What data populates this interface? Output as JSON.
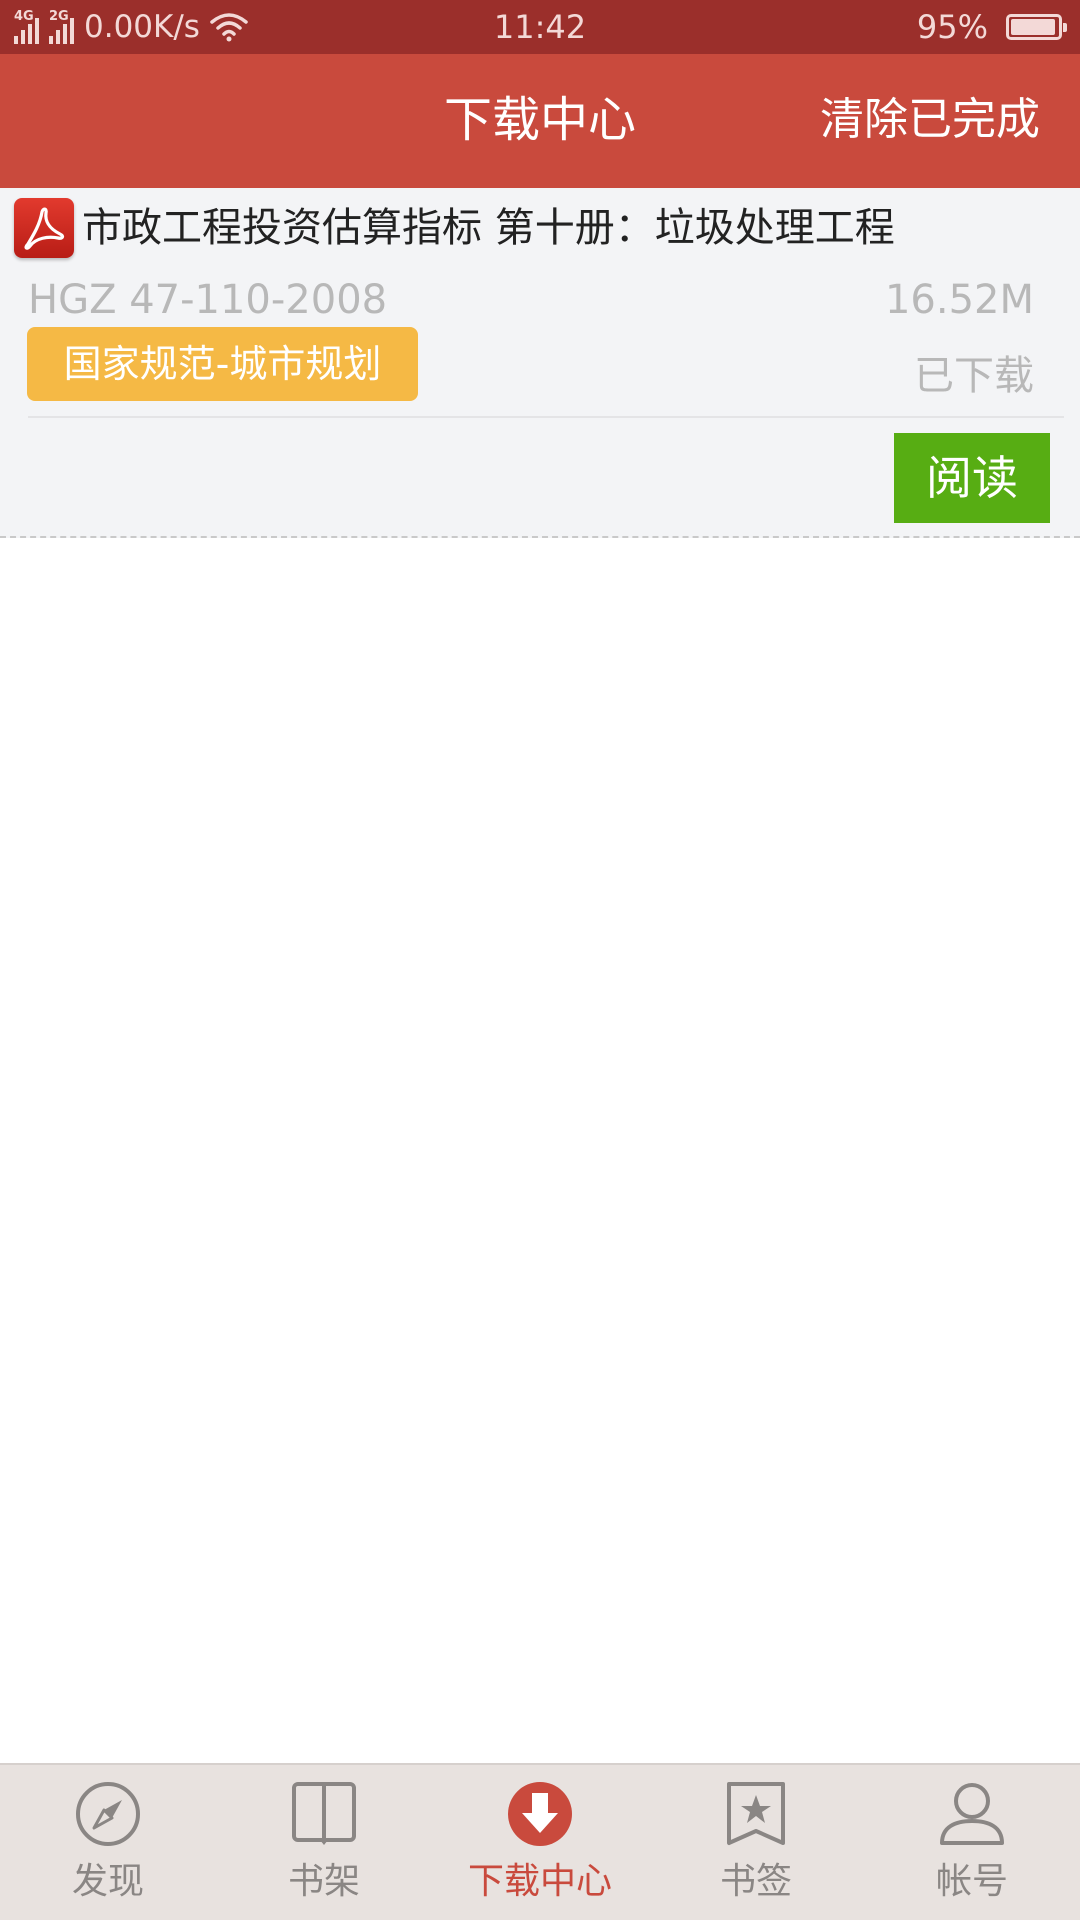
{
  "status_bar": {
    "network1": "4G",
    "network2": "2G",
    "speed": "0.00K/s",
    "time": "11:42",
    "battery": "95%",
    "battery_level": 0.95
  },
  "header": {
    "title": "下载中心",
    "clear_label": "清除已完成"
  },
  "downloads": [
    {
      "icon": "pdf-icon",
      "title": "市政工程投资估算指标 第十册：垃圾处理工程",
      "code": "HGZ 47-110-2008",
      "size": "16.52M",
      "category": "国家规范-城市规划",
      "status": "已下载",
      "action_label": "阅读"
    }
  ],
  "bottom_nav": {
    "items": [
      {
        "label": "发现",
        "icon": "compass-icon",
        "active": false
      },
      {
        "label": "书架",
        "icon": "book-icon",
        "active": false
      },
      {
        "label": "下载中心",
        "icon": "download-icon",
        "active": true
      },
      {
        "label": "书签",
        "icon": "bookmark-icon",
        "active": false
      },
      {
        "label": "帐号",
        "icon": "user-icon",
        "active": false
      }
    ]
  },
  "colors": {
    "status_bar": "#9b2f2b",
    "header": "#c94a3d",
    "badge": "#f5b945",
    "read_button": "#57ad13",
    "nav_active": "#c94a3d",
    "nav_inactive": "#8a8684"
  }
}
